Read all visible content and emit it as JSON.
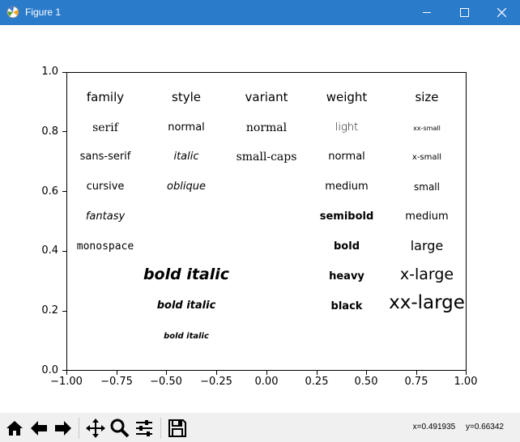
{
  "window": {
    "title": "Figure 1",
    "minimize_icon": "minimize-icon",
    "maximize_icon": "maximize-icon",
    "close_icon": "close-icon"
  },
  "axes": {
    "y_ticks": [
      "1.0",
      "0.8",
      "0.6",
      "0.4",
      "0.2",
      "0.0"
    ],
    "x_ticks": [
      "−1.00",
      "−0.75",
      "−0.50",
      "−0.25",
      "0.00",
      "0.25",
      "0.50",
      "0.75",
      "1.00"
    ],
    "xlim": [
      -1.0,
      1.0
    ],
    "ylim": [
      0.0,
      1.0
    ]
  },
  "figure_text": {
    "family": {
      "header": "family",
      "items": [
        "serif",
        "sans-serif",
        "cursive",
        "fantasy",
        "monospace"
      ]
    },
    "style": {
      "header": "style",
      "items": [
        "normal",
        "italic",
        "oblique"
      ]
    },
    "variant": {
      "header": "variant",
      "items": [
        "normal",
        "small-caps"
      ]
    },
    "weight": {
      "header": "weight",
      "items": [
        "light",
        "normal",
        "medium",
        "semibold",
        "bold",
        "heavy",
        "black"
      ]
    },
    "size": {
      "header": "size",
      "items": [
        "xx-small",
        "x-small",
        "small",
        "medium",
        "large",
        "x-large",
        "xx-large"
      ]
    },
    "bold_italic": [
      "bold italic",
      "bold italic",
      "bold italic"
    ]
  },
  "toolbar": {
    "buttons": [
      "home-icon",
      "back-icon",
      "forward-icon",
      "pan-icon",
      "zoom-icon",
      "subplots-icon",
      "save-icon"
    ],
    "coord_x": "x=0.491935",
    "coord_y": "y=0.66342"
  }
}
